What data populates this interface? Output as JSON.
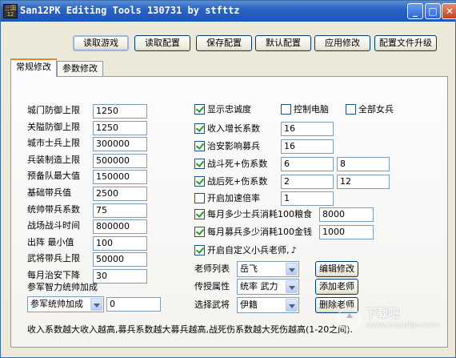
{
  "window": {
    "title": "San12PK Editing Tools 130731 by stfttz",
    "icon_text": "三国\n12PK",
    "controls": {
      "minimize": "_",
      "maximize": "□",
      "close": "✕"
    }
  },
  "toolbar": {
    "read_game": "读取游戏",
    "read_config": "读取配置",
    "save_config": "保存配置",
    "default_config": "默认配置",
    "apply_changes": "应用修改",
    "upgrade_config": "配置文件升级"
  },
  "tabs": [
    "常规修改",
    "参数修改"
  ],
  "left_fields": [
    {
      "label": "城门防御上限",
      "value": "1250"
    },
    {
      "label": "关隘防御上限",
      "value": "1250"
    },
    {
      "label": "城市士兵上限",
      "value": "300000"
    },
    {
      "label": "兵装制造上限",
      "value": "500000"
    },
    {
      "label": "预备队最大值",
      "value": "150000"
    },
    {
      "label": "基础带兵值",
      "value": "2500"
    },
    {
      "label": "统帅带兵系数",
      "value": "75"
    },
    {
      "label": "战场战斗时间",
      "value": "800000"
    },
    {
      "label": "出阵 最小值",
      "value": "100"
    },
    {
      "label": "武将带兵上限",
      "value": "50000"
    },
    {
      "label": "每月治安下降",
      "value": "30"
    }
  ],
  "advisor": {
    "section_label": "参军智力统帅加成",
    "dropdown_value": "参军统帅加成",
    "input_value": "0"
  },
  "top_checks": [
    {
      "label": "显示忠诚度",
      "checked": true
    },
    {
      "label": "控制电脑",
      "checked": false
    },
    {
      "label": "全部女兵",
      "checked": false
    }
  ],
  "right_rows": [
    {
      "label": "收入增长系数",
      "checked": true,
      "v1": "16"
    },
    {
      "label": "治安影响募兵",
      "checked": true,
      "v1": "16"
    },
    {
      "label": "战斗死+伤系数",
      "checked": true,
      "v1": "6",
      "v2": "8"
    },
    {
      "label": "战后死+伤系数",
      "checked": true,
      "v1": "2",
      "v2": "12"
    },
    {
      "label": "开启加速倍率",
      "checked": false,
      "v1": "1"
    }
  ],
  "monthly_rows": [
    {
      "label": "每月多少士兵消耗100粮食",
      "checked": true,
      "value": "8000"
    },
    {
      "label": "每月募兵多少消耗100金钱",
      "checked": true,
      "value": "1000"
    }
  ],
  "custom_teacher": {
    "label": "开启自定义小兵老师, ♪",
    "checked": true
  },
  "teacher_rows": [
    {
      "label": "老师列表",
      "value": "岳飞",
      "button": "编辑修改"
    },
    {
      "label": "传授属性",
      "value": "统率 武力",
      "button": "添加老师"
    },
    {
      "label": "选择武将",
      "value": "伊籍",
      "button": "删除老师"
    }
  ],
  "footer_note": "收入系数越大收入越高,募兵系数越大募兵越高,战死伤系数越大死伤越高(1-20之间).",
  "watermark": {
    "name": "下载吧",
    "url": "www.xiazaiba.com"
  }
}
